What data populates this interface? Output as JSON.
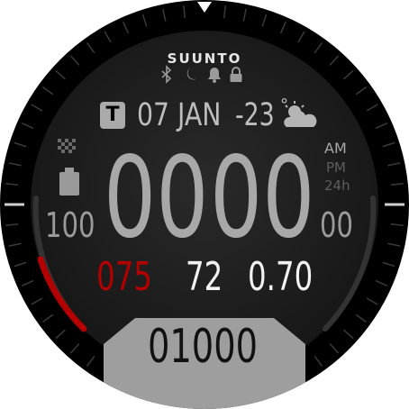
{
  "brand": "SUUNTO",
  "status_icons": [
    "bluetooth-icon",
    "moon-icon",
    "bell-icon",
    "lock-icon"
  ],
  "date": {
    "day_badge": "T",
    "text": "07 JAN"
  },
  "weather": {
    "temperature": "-23",
    "degree": "°",
    "icon": "sun-cloud-icon"
  },
  "time": {
    "hours": "00",
    "minutes": "00",
    "seconds": "00",
    "am": "AM",
    "pm": "PM",
    "h24": "24h"
  },
  "battery": {
    "percent": "100",
    "icon": "battery-icon"
  },
  "metrics": {
    "heart_rate": "075",
    "value_2": "72",
    "value_3": "0.70"
  },
  "steps": "01000",
  "gauge": {
    "left_fill_fraction": 0.25
  },
  "colors": {
    "background": "#000000",
    "dial": "#1c1c1c",
    "accent_red": "#b30000",
    "text_white": "#f2f2f2",
    "text_gray": "#8a8a8a",
    "bottom_plate": "#9e9e9e"
  }
}
